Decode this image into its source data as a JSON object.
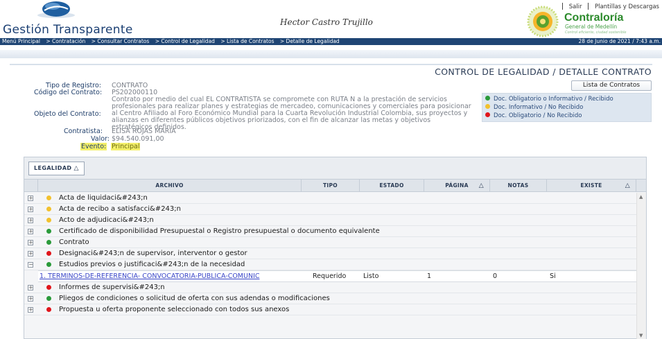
{
  "header": {
    "logo_text_prefix": "Gestión Tra",
    "logo_text_mid": "n",
    "logo_text_suffix": "sparente",
    "user_name": "Hector Castro Trujillo",
    "top_links": [
      "Salir",
      "Plantillas y Descargas"
    ],
    "contraloria_name": "Contraloría",
    "contraloria_sub": "General de Medellín",
    "contraloria_slogan": "Control eficiente, ciudad sostenible"
  },
  "breadcrumb": {
    "items": [
      "Menú Principal",
      "> Contratación",
      "> Consultar Contratos",
      "> Control de Legalidad",
      "> Lista de Contratos",
      "> Detalle de Legalidad"
    ],
    "date": "28 de Junio de 2021 / 7:43 a.m."
  },
  "page_title": "CONTROL DE LEGALIDAD / DETALLE CONTRATO",
  "details": {
    "tipo_label": "Tipo de Registro:",
    "tipo_value": "CONTRATO",
    "codigo_label": "Código del Contrato:",
    "codigo_value": "PS202000110",
    "objeto_label": "Objeto del Contrato:",
    "objeto_value": "Contrato por medio del cual EL CONTRATISTA se compromete con RUTA N a la prestación de servicios profesionales para realizar planes y estrategias de mercadeo, comunicaciones y comerciales para posicionar al Centro Afiliado al Foro Económico Mundial para la Cuarta Revolución Industrial Colombia, sus proyectos y alianzas en diferentes públicos objetivos priorizados, con el fin de alcanzar las metas y objetivos estratégicos definidos.",
    "contratista_label": "Contratista:",
    "contratista_value": "ELISA ROJAS MARIA",
    "valor_label": "Valor:",
    "valor_value": "$94.540.091,00",
    "evento_label": "Evento:",
    "evento_value": "Principal"
  },
  "buttons": {
    "lista_contratos": "Lista de Contratos"
  },
  "legend": [
    {
      "label": "Doc. Obligatorio o Informativo / Recibido",
      "color": "#2a9a3a"
    },
    {
      "label": "Doc. Informativo / No Recibido",
      "color": "#f2c12e"
    },
    {
      "label": "Doc. Obligatorio / No Recibido",
      "color": "#e0151b"
    }
  ],
  "grid": {
    "group_label": "LEGALIDAD",
    "group_arrow": "△",
    "columns": [
      "ARCHIVO",
      "TIPO",
      "ESTADO",
      "PÁGINA",
      "NOTAS",
      "EXISTE"
    ],
    "sort_arrow": "△",
    "rows": [
      {
        "label": "Acta de liquidaci&#243;n",
        "status": "yellow",
        "expander": "+"
      },
      {
        "label": "Acta de recibo a satisfacci&#243;n",
        "status": "yellow",
        "expander": "+"
      },
      {
        "label": "Acto de adjudicaci&#243;n",
        "status": "yellow",
        "expander": "+"
      },
      {
        "label": "Certificado de disponibilidad Presupuestal o Registro presupuestal o documento equivalente",
        "status": "green",
        "expander": "+"
      },
      {
        "label": "Contrato",
        "status": "green",
        "expander": "+"
      },
      {
        "label": "Designaci&#243;n de supervisor, interventor o gestor",
        "status": "red",
        "expander": "+"
      },
      {
        "label": "Estudios previos o justificaci&#243;n de la necesidad",
        "status": "green",
        "expander": "−"
      },
      {
        "label": "Informes de supervisi&#243;n",
        "status": "red",
        "expander": "+"
      },
      {
        "label": "Pliegos de condiciones o solicitud de oferta con sus adendas o modificaciones",
        "status": "green",
        "expander": "+"
      },
      {
        "label": "Propuesta u oferta proponente seleccionado con todos sus anexos",
        "status": "red",
        "expander": "+"
      }
    ],
    "detail": {
      "archivo": "1. TERMINOS-DE-REFERENCIA- CONVOCATORIA-PUBLICA-COMUNIC",
      "tipo": "Requerido",
      "estado": "Listo",
      "pagina": "1",
      "notas": "0",
      "existe": "Si"
    }
  }
}
